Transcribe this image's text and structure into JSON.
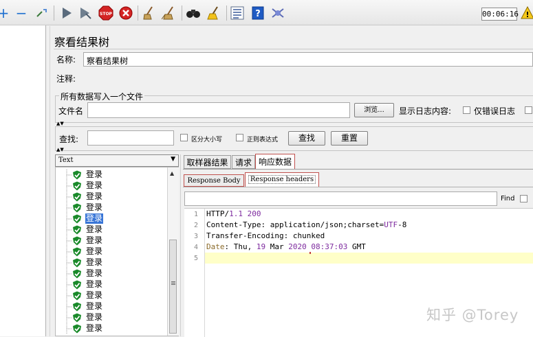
{
  "toolbar": {
    "icons": [
      "add-icon",
      "remove-icon",
      "expand-icon",
      "start-icon",
      "start-no-pause-icon",
      "stop-icon",
      "shutdown-icon",
      "clear-icon",
      "clear-all-icon",
      "search-icon",
      "reset-search-icon",
      "function-helper-icon",
      "help-icon",
      "remote-icon"
    ],
    "timer": "00:06:16"
  },
  "panel": {
    "title": "察看结果树",
    "name_label": "名称:",
    "name_value": "察看结果树",
    "comment_label": "注释:",
    "comment_value": "",
    "file_section_title": "所有数据写入一个文件",
    "file_label": "文件名",
    "file_value": "",
    "browse_button": "浏览...",
    "log_label": "显示日志内容:",
    "errors_only_label": "仅错误日志"
  },
  "search": {
    "label": "查找:",
    "value": "",
    "case_label": "区分大小写",
    "regex_label": "正则表达式",
    "find_button": "查找",
    "reset_button": "重置"
  },
  "renderer": {
    "selected": "Text"
  },
  "results": {
    "items": [
      "登录",
      "登录",
      "登录",
      "登录",
      "登录",
      "登录",
      "登录",
      "登录",
      "登录",
      "登录",
      "登录",
      "登录",
      "登录",
      "登录",
      "登录"
    ],
    "selected_index": 4
  },
  "detail_tabs": {
    "tabs": [
      "取样器结果",
      "请求",
      "响应数据"
    ],
    "active": "响应数据"
  },
  "response_subtabs": {
    "tabs": [
      "Response Body",
      "Response headers"
    ],
    "active": "Response headers",
    "find_label": "Find",
    "find_value": ""
  },
  "response_headers": {
    "line_numbers": [
      "1",
      "2",
      "3",
      "4",
      "5"
    ],
    "line1": {
      "a": "HTTP/",
      "b": "1.1 200"
    },
    "line2": {
      "a": "Content-Type: application/json;charset=",
      "b": "UTF",
      "c": "-8"
    },
    "line3": {
      "a": "Transfer-Encoding: chunked"
    },
    "line4": {
      "a": "Date",
      "b": ": Thu, ",
      "c": "19",
      "d": " Mar ",
      "e": "2020",
      "f": " 08:37:03",
      "g": " GMT"
    }
  },
  "watermark": "知乎 @Torey",
  "colors": {
    "selection": "#3875d7",
    "current_line": "#ffffc8",
    "tab_highlight": "#c0504d",
    "success": "#1a8a2a"
  }
}
